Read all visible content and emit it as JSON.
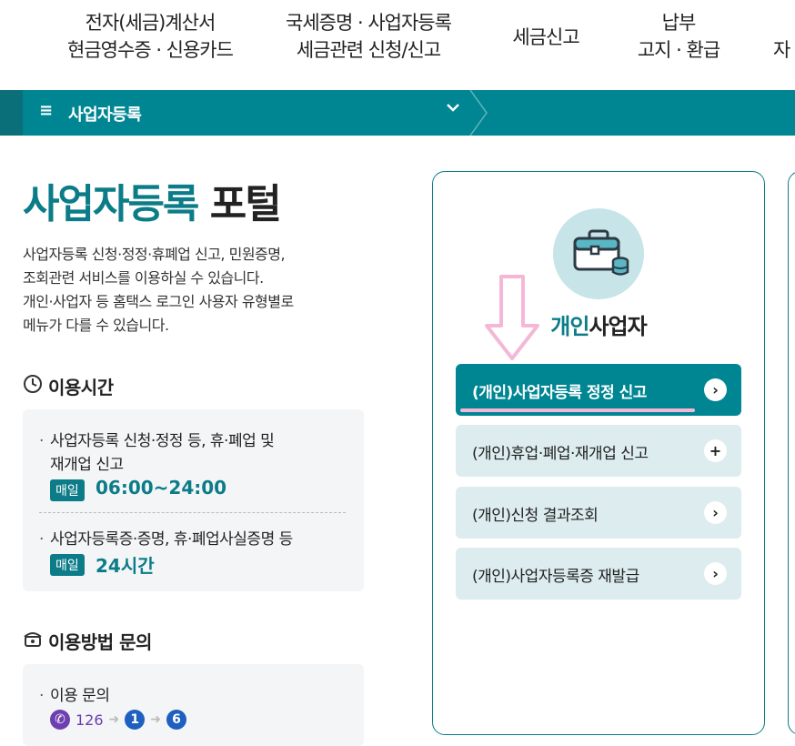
{
  "top_nav": [
    {
      "line1": "전자(세금)계산서",
      "line2": "현금영수증 · 신용카드"
    },
    {
      "line1": "국세증명 · 사업자등록",
      "line2": "세금관련 신청/신고"
    },
    {
      "line1": "세금신고",
      "line2": ""
    },
    {
      "line1": "납부",
      "line2": "고지 · 환급"
    },
    {
      "line1": "자",
      "line2": ""
    }
  ],
  "menu_bar": {
    "hamburger": "≡",
    "label": "사업자등록",
    "chevron": "⌄"
  },
  "page_title": {
    "accent": "사업자등록",
    "rest": "포털"
  },
  "description": [
    "사업자등록 신청·정정·휴폐업 신고, 민원증명,",
    "조회관련 서비스를 이용하실 수 있습니다.",
    "개인·사업자 등 홈택스 로그인 사용자 유형별로",
    "메뉴가 다를 수 있습니다."
  ],
  "usage_time": {
    "heading": "이용시간",
    "item1_line1": "사업자등록 신청·정정 등, 휴·폐업 및",
    "item1_line2": "재개업 신고",
    "item1_badge": "매일",
    "item1_time": "06:00~24:00",
    "item2_line1": "사업자등록증·증명, 휴·폐업사실증명 등",
    "item2_badge": "매일",
    "item2_time": "24시간"
  },
  "inquiry": {
    "heading": "이용방법 문의",
    "item1": "이용 문의",
    "phone_number": "126",
    "step1": "1",
    "step2": "6"
  },
  "card": {
    "title_accent": "개인",
    "title_rest": "사업자",
    "items": [
      {
        "label": "(개인)사업자등록 정정 신고",
        "btn": "›"
      },
      {
        "label": "(개인)휴업·폐업·재개업 신고",
        "btn": "+"
      },
      {
        "label": "(개인)신청 결과조회",
        "btn": "›"
      },
      {
        "label": "(개인)사업자등록증 재발급",
        "btn": "›"
      }
    ]
  },
  "colors": {
    "teal": "#008693",
    "teal_dark": "#0b7c88",
    "annotation_pink": "#f4b8d6"
  }
}
